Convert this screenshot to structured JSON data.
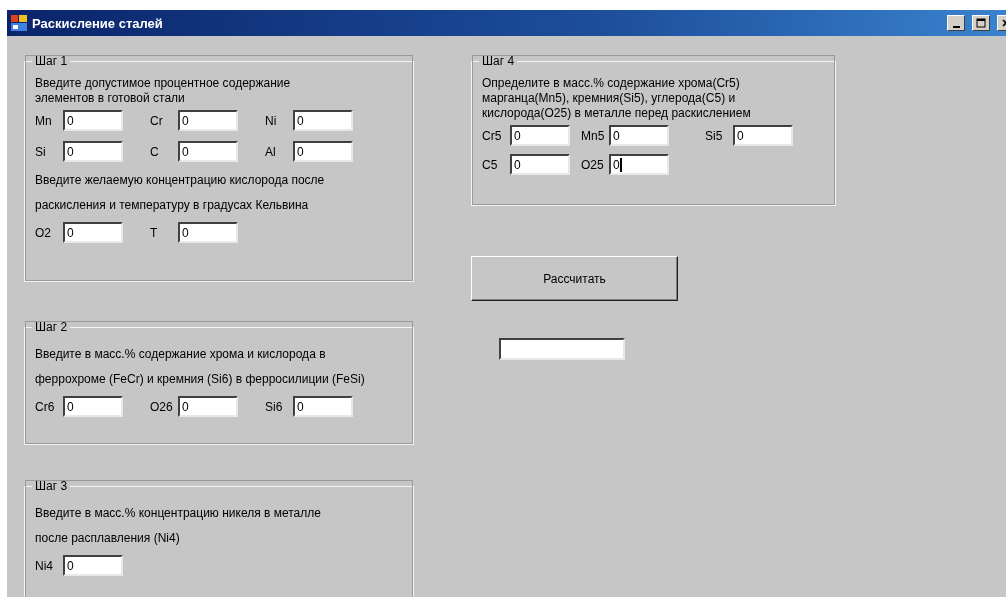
{
  "window": {
    "title": "Раскисление сталей"
  },
  "left_groups": [
    {
      "title": "Шаг 1",
      "sections": [
        {
          "text": "Введите допустимое процентное содержание\nэлементов в готовой стали",
          "rows": [
            [
              {
                "label": "Mn",
                "value": "0",
                "focused": false
              },
              {
                "label": "Cr",
                "value": "0",
                "focused": false
              },
              {
                "label": "Ni",
                "value": "0",
                "focused": false
              }
            ],
            [
              {
                "label": "Si",
                "value": "0",
                "focused": false
              },
              {
                "label": "C",
                "value": "0",
                "focused": false
              },
              {
                "label": "Al",
                "value": "0",
                "focused": false
              }
            ]
          ]
        },
        {
          "text": "Введите желаемую концентрацию кислорода после\nраскисления и температуру в градусах Кельвина",
          "rows": [
            [
              {
                "label": "O2",
                "value": "0",
                "focused": false
              },
              {
                "label": "T",
                "value": "0",
                "focused": false
              }
            ]
          ]
        }
      ]
    },
    {
      "title": "Шаг 2",
      "sections": [
        {
          "text": "Введите в масс.% содержание хрома и кислорода в\nферрохроме (FeCr)  и кремния (Si6) в ферросилиции (FeSi)",
          "rows": [
            [
              {
                "label": "Cr6",
                "value": "0",
                "focused": false
              },
              {
                "label": "O26",
                "value": "0",
                "focused": false
              },
              {
                "label": "Si6",
                "value": "0",
                "focused": false
              }
            ]
          ]
        }
      ]
    },
    {
      "title": "Шаг 3",
      "sections": [
        {
          "text": "Введите в масс.% концентрацию никеля в металле\nпосле расплавления (Ni4)",
          "rows": [
            [
              {
                "label": "Ni4",
                "value": "0",
                "focused": false
              }
            ]
          ]
        }
      ]
    }
  ],
  "right_group": {
    "title": "Шаг 4",
    "sections": [
      {
        "text": "Определите в масс.% содержание хрома(Cr5)\nмарганца(Mn5), кремния(Si5), углерода(C5) и\nкислорода(O25) в металле перед раскислением",
        "rows": [
          [
            {
              "label": "Cr5",
              "value": "0",
              "focused": false
            },
            {
              "label": "Mn5",
              "value": "0",
              "focused": false
            },
            {
              "label": "Si5",
              "value": "0",
              "focused": false
            }
          ],
          [
            {
              "label": "C5",
              "value": "0",
              "focused": false
            },
            {
              "label": "O25",
              "value": "0",
              "focused": true
            }
          ]
        ]
      }
    ]
  },
  "calculate_button": {
    "label": "Рассчитать"
  }
}
